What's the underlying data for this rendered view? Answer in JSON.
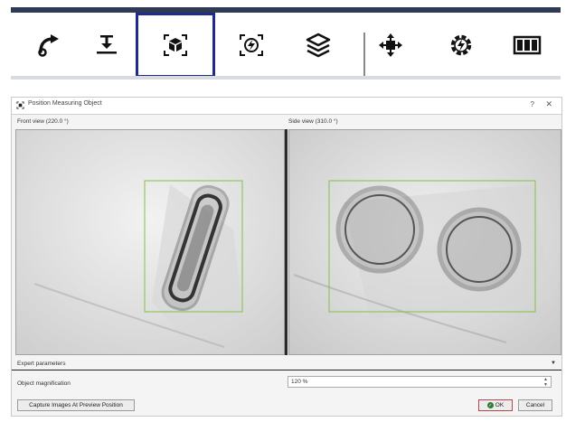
{
  "toolbar": {
    "buttons": [
      {
        "name": "curve-arrow-tool",
        "icon": "curve-arrow-icon"
      },
      {
        "name": "align-center-tool",
        "icon": "align-down-icon"
      },
      {
        "name": "position-object-tool",
        "icon": "box-target-icon",
        "selected": true
      },
      {
        "name": "energy-target-tool",
        "icon": "bolt-target-icon"
      },
      {
        "name": "layers-tool",
        "icon": "layers-icon"
      },
      {
        "name": "move-tool",
        "icon": "move-icon"
      },
      {
        "name": "bolt-gear-tool",
        "icon": "bolt-gear-icon"
      },
      {
        "name": "columns-tool",
        "icon": "columns-icon"
      }
    ],
    "selected_color": "#1f2a8a"
  },
  "dialog": {
    "title": "Position Measuring Object",
    "help": "?",
    "close": "✕",
    "front_view_label": "Front view (220.0 °)",
    "side_view_label": "Side view (310.0 °)",
    "selection_box_color": "#7fc24a",
    "expert_parameters_label": "Expert parameters",
    "object_magnification_label": "Object magnification",
    "object_magnification_value": "120 %",
    "capture_button": "Capture Images At Preview Position",
    "ok_button": "OK",
    "cancel_button": "Cancel"
  }
}
